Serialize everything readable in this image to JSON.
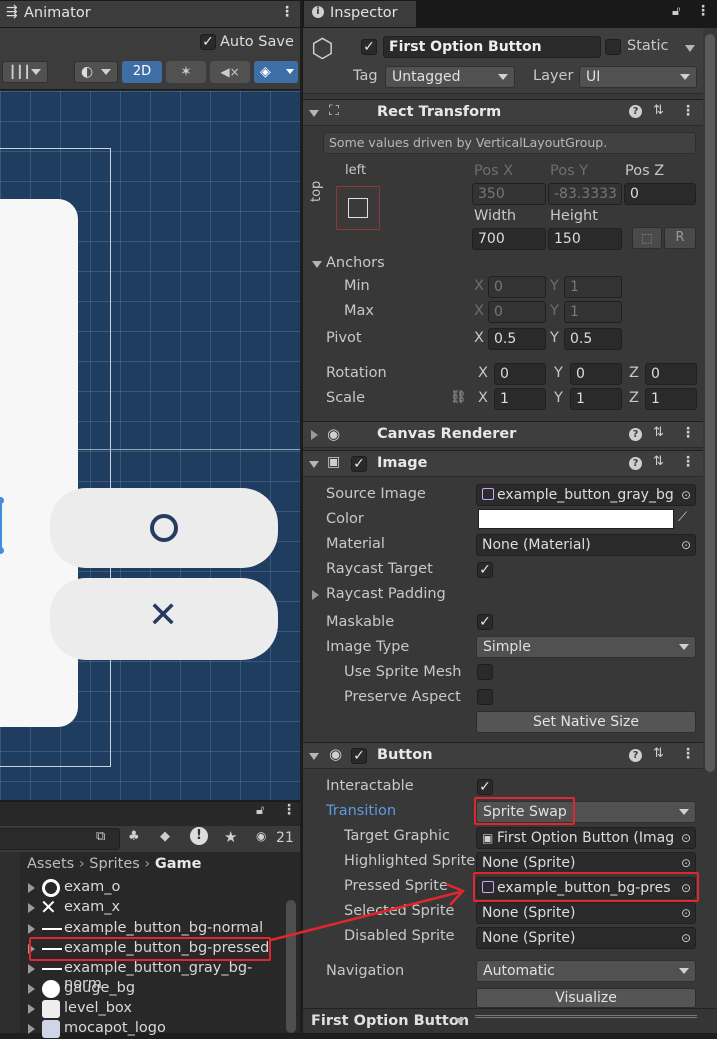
{
  "animator": {
    "tab_title": "Animator",
    "auto_save_label": "Auto Save",
    "mode_2d": "2D"
  },
  "project": {
    "breadcrumb": [
      "Assets",
      "Sprites",
      "Game"
    ],
    "hidden_count": "21",
    "assets": [
      {
        "name": "exam_o",
        "icon": "circle-icon"
      },
      {
        "name": "exam_x",
        "icon": "x-icon"
      },
      {
        "name": "example_button_bg-normal",
        "icon": "line-icon"
      },
      {
        "name": "example_button_bg-pressed",
        "icon": "line-icon"
      },
      {
        "name": "example_button_gray_bg-norm",
        "icon": "line-icon"
      },
      {
        "name": "gauge_bg",
        "icon": "circle-icon"
      },
      {
        "name": "level_box",
        "icon": "square-icon"
      },
      {
        "name": "mocapot_logo",
        "icon": "logo-icon"
      }
    ]
  },
  "inspector": {
    "tab_title": "Inspector",
    "object_name": "First Option Button",
    "static_label": "Static",
    "tag_label": "Tag",
    "tag_value": "Untagged",
    "layer_label": "Layer",
    "layer_value": "UI",
    "rect": {
      "title": "Rect Transform",
      "driven_note": "Some values driven by VerticalLayoutGroup.",
      "anchor_h": "left",
      "anchor_v": "top",
      "posx_label": "Pos X",
      "posx": "350",
      "posy_label": "Pos Y",
      "posy": "-83.3333",
      "posz_label": "Pos Z",
      "posz": "0",
      "width_label": "Width",
      "width": "700",
      "height_label": "Height",
      "height": "150",
      "r_button": "R",
      "anchors_label": "Anchors",
      "min_label": "Min",
      "min_x": "0",
      "min_y": "1",
      "max_label": "Max",
      "max_x": "0",
      "max_y": "1",
      "pivot_label": "Pivot",
      "pivot_x": "0.5",
      "pivot_y": "0.5",
      "rotation_label": "Rotation",
      "rot_x": "0",
      "rot_y": "0",
      "rot_z": "0",
      "scale_label": "Scale",
      "scale_x": "1",
      "scale_y": "1",
      "scale_z": "1",
      "x": "X",
      "y": "Y",
      "z": "Z"
    },
    "canvas_renderer": {
      "title": "Canvas Renderer"
    },
    "image": {
      "title": "Image",
      "source_image_label": "Source Image",
      "source_image": "example_button_gray_bg",
      "color_label": "Color",
      "color_value": "#ffffff",
      "material_label": "Material",
      "material": "None (Material)",
      "raycast_target_label": "Raycast Target",
      "raycast_padding_label": "Raycast Padding",
      "maskable_label": "Maskable",
      "image_type_label": "Image Type",
      "image_type": "Simple",
      "use_sprite_mesh_label": "Use Sprite Mesh",
      "preserve_aspect_label": "Preserve Aspect",
      "set_native_size": "Set Native Size"
    },
    "button": {
      "title": "Button",
      "interactable_label": "Interactable",
      "transition_label": "Transition",
      "transition": "Sprite Swap",
      "target_graphic_label": "Target Graphic",
      "target_graphic": "First Option Button (Imag",
      "highlighted_label": "Highlighted Sprite",
      "highlighted": "None (Sprite)",
      "pressed_label": "Pressed Sprite",
      "pressed": "example_button_bg-pres",
      "selected_label": "Selected Sprite",
      "selected": "None (Sprite)",
      "disabled_label": "Disabled Sprite",
      "disabled": "None (Sprite)",
      "navigation_label": "Navigation",
      "navigation": "Automatic",
      "visualize": "Visualize"
    },
    "footer_title": "First Option Button"
  },
  "colors": {
    "highlight": "#e0262f",
    "scene_bg": "#1f3d5e",
    "accent_blue": "#3d6ea6"
  }
}
